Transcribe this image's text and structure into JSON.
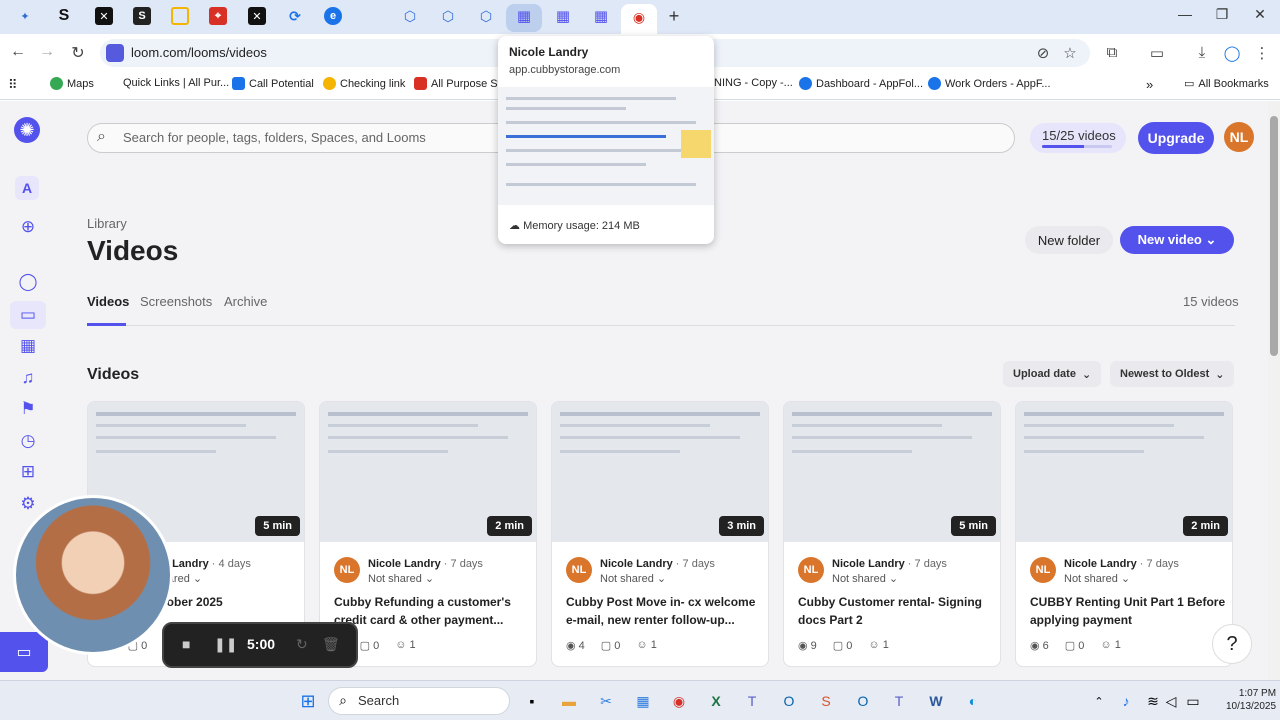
{
  "browser": {
    "url": "loom.com/looms/videos",
    "new_tab": "+",
    "window_controls": [
      "—",
      "❐",
      "✕"
    ],
    "back": "←",
    "forward": "→",
    "reload": "↻"
  },
  "bookmarks": [
    {
      "label": "Maps",
      "color": "#34a853"
    },
    {
      "label": "Quick Links | All Pur...",
      "color": "#ffffff"
    },
    {
      "label": "Call Potential",
      "color": "#1a73e8"
    },
    {
      "label": "Checking link",
      "color": "#f4b400"
    },
    {
      "label": "All Purpose Sto",
      "color": "#d93025"
    },
    {
      "label": "NING - Copy -...",
      "color": "#ffffff"
    },
    {
      "label": "Dashboard - AppFol...",
      "color": "#1a73e8"
    },
    {
      "label": "Work Orders - AppF...",
      "color": "#1a73e8"
    }
  ],
  "all_bookmarks": "All Bookmarks",
  "tab_hover": {
    "title": "Nicole Landry",
    "url": "app.cubbystorage.com",
    "memory": "Memory usage: 214 MB"
  },
  "loom": {
    "workspace_initial": "A",
    "search_placeholder": "Search for people, tags, folders, Spaces, and Looms",
    "quota": "15/25 videos",
    "quota_used": 15,
    "quota_total": 25,
    "upgrade": "Upgrade",
    "user_initials": "NL",
    "breadcrumb": "Library",
    "page_title": "Videos",
    "new_folder": "New folder",
    "new_video": "New video",
    "tabs": [
      "Videos",
      "Screenshots",
      "Archive"
    ],
    "video_count": "15 videos",
    "section_title": "Videos",
    "sort_field": "Upload date",
    "sort_order": "Newest to Oldest",
    "help": "?"
  },
  "cards": [
    {
      "duration": "5 min",
      "author": "Nicole Landry",
      "age": " · 4 days",
      "shared": "Not shared",
      "title": "...ge - 9 October 2025",
      "views": "",
      "comments": "0",
      "reactions": ""
    },
    {
      "duration": "2 min",
      "author": "Nicole Landry",
      "age": " · 7 days",
      "shared": "Not shared",
      "title": "Cubby Refunding a customer's credit card & other payment...",
      "views": "",
      "comments": "0",
      "reactions": "1"
    },
    {
      "duration": "3 min",
      "author": "Nicole Landry",
      "age": " · 7 days",
      "shared": "Not shared",
      "title": "Cubby Post Move in- cx welcome e-mail, new renter follow-up...",
      "views": "4",
      "comments": "0",
      "reactions": "1"
    },
    {
      "duration": "5 min",
      "author": "Nicole Landry",
      "age": " · 7 days",
      "shared": "Not shared",
      "title": "Cubby Customer rental- Signing docs Part 2",
      "views": "9",
      "comments": "0",
      "reactions": "1"
    },
    {
      "duration": "2 min",
      "author": "Nicole Landry",
      "age": " · 7 days",
      "shared": "Not shared",
      "title": "CUBBY Renting Unit Part 1 Before applying payment",
      "views": "6",
      "comments": "0",
      "reactions": "1"
    }
  ],
  "recorder": {
    "timer": "5:00"
  },
  "taskbar": {
    "search": "Search",
    "time": "1:07 PM",
    "date": "10/13/2025"
  },
  "colors": {
    "accent": "#5352ed",
    "avatar": "#d9762b"
  }
}
